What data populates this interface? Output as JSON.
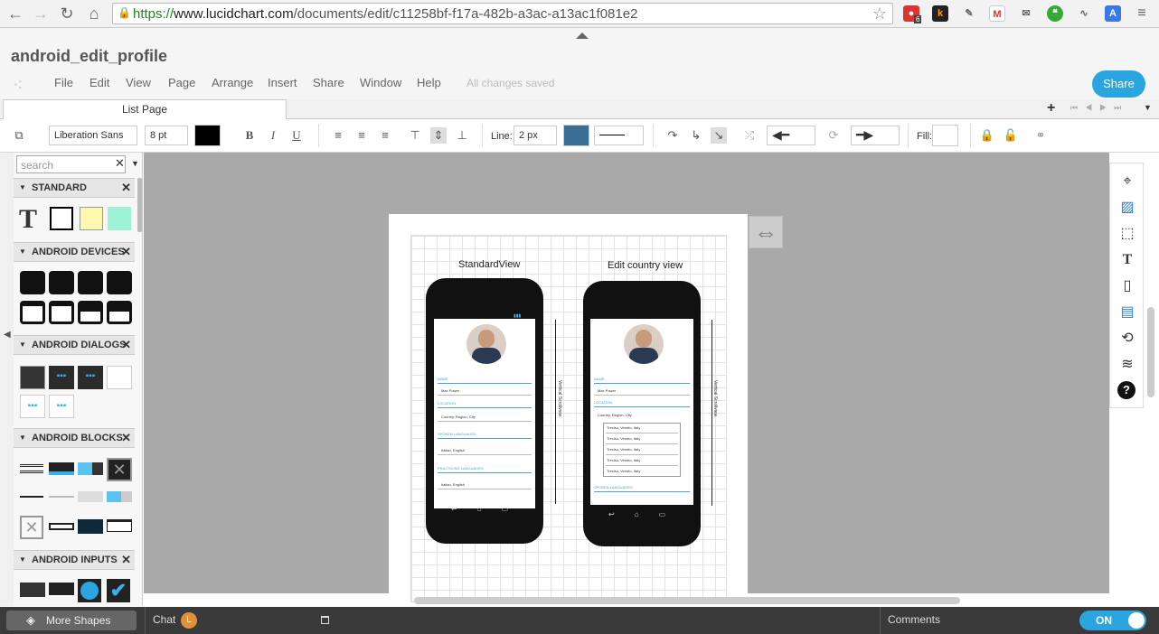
{
  "browser": {
    "url_scheme": "https://",
    "url_host": "www.lucidchart.com",
    "url_path": "/documents/edit/c11258bf-f17a-482b-a3ac-a13ac1f081e2",
    "badge_count": "6"
  },
  "header": {
    "doc_title": "android_edit_profile",
    "menu": [
      "File",
      "Edit",
      "View",
      "Page",
      "Arrange",
      "Insert",
      "Share",
      "Window",
      "Help"
    ],
    "status": "All changes saved",
    "share_label": "Share"
  },
  "tabs": {
    "list_page_label": "List Page"
  },
  "toolbar": {
    "font_family": "Liberation Sans",
    "font_size": "8 pt",
    "text_color": "#000000",
    "bold": "B",
    "italic": "I",
    "underline": "U",
    "line_label": "Line:",
    "line_width": "2 px",
    "line_color": "#3b6e96",
    "fill_label": "Fill:"
  },
  "left_panel": {
    "search_placeholder": "search",
    "sections": [
      "STANDARD",
      "ANDROID DEVICES",
      "ANDROID DIALOGS",
      "ANDROID BLOCKS",
      "ANDROID INPUTS"
    ]
  },
  "canvas": {
    "phone1_label": "StandardView",
    "phone2_label": "Edit country view",
    "vertical_label": "Vertical Scrollview",
    "name_label": "NAME",
    "name_value": "Max Power",
    "location_label": "LOCATION",
    "location_value": "Country, Region, City",
    "spoken_label": "SPOKEN LANGUAGES",
    "spoken_value": "Italian, English",
    "practicing_label": "PRACTICING LANGUAGES",
    "practicing_value": "Italian, English",
    "list_items": [
      "Treviso, Veneto, Italy",
      "Treviso, Veneto, Italy",
      "Treviso, Veneto, Italy",
      "Treviso, Veneto, Italy",
      "Treviso, Veneto, Italy"
    ]
  },
  "bottom": {
    "more_shapes": "More Shapes",
    "chat": "Chat",
    "chat_avatar": "L",
    "comments": "Comments",
    "toggle": "ON"
  }
}
